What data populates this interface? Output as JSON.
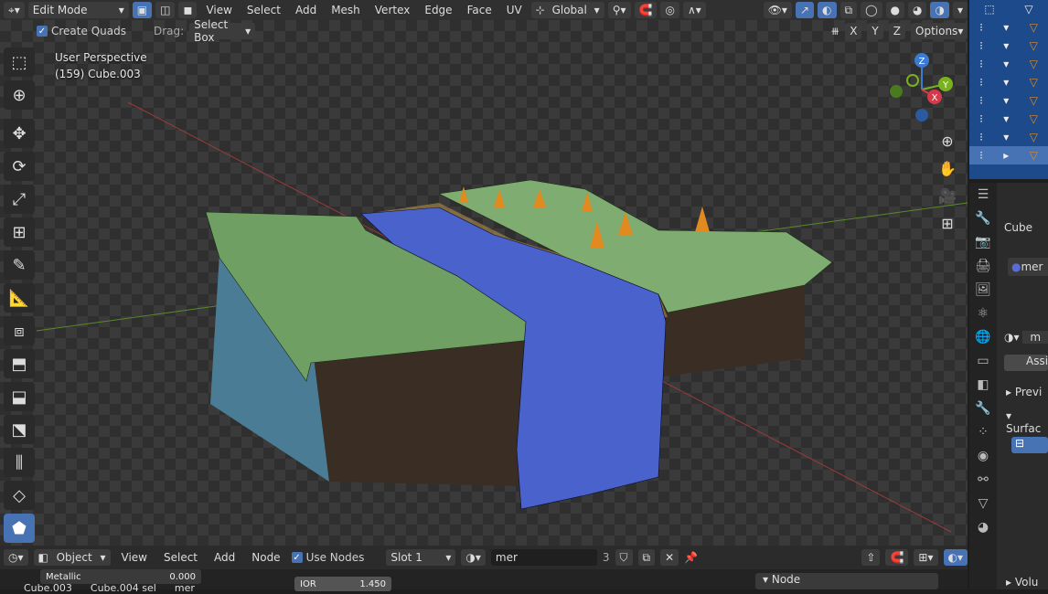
{
  "header": {
    "mode": "Edit Mode",
    "menus": [
      "View",
      "Select",
      "Add",
      "Mesh",
      "Vertex",
      "Edge",
      "Face",
      "UV"
    ],
    "orientation": "Global"
  },
  "toolbar2": {
    "create_quads": "Create Quads",
    "drag_label": "Drag:",
    "drag_value": "Select Box",
    "axes": [
      "X",
      "Y",
      "Z"
    ],
    "options": "Options"
  },
  "viewport": {
    "perspective": "User Perspective",
    "object_info": "(159) Cube.003"
  },
  "gizmo": {
    "x": "X",
    "y": "Y",
    "z": "Z"
  },
  "outliner": {
    "rows": 9
  },
  "properties": {
    "object_name": "Cube",
    "material_short": "mer",
    "slot_short": "m",
    "assign": "Assi",
    "preview": "Previ",
    "surface": "Surfac",
    "volume": "Volu"
  },
  "node_header": {
    "object": "Object",
    "menus": [
      "View",
      "Select",
      "Add",
      "Node"
    ],
    "use_nodes": "Use Nodes",
    "slot": "Slot 1",
    "material": "mer",
    "users": "3"
  },
  "nodes": {
    "metallic_label": "Metallic",
    "metallic_value": "0.000",
    "ior_label": "IOR",
    "ior_value": "1.450",
    "cube_a": "Cube.003",
    "cube_b": "Cube.004 sel",
    "mer": "mer",
    "node_panel": "Node"
  }
}
